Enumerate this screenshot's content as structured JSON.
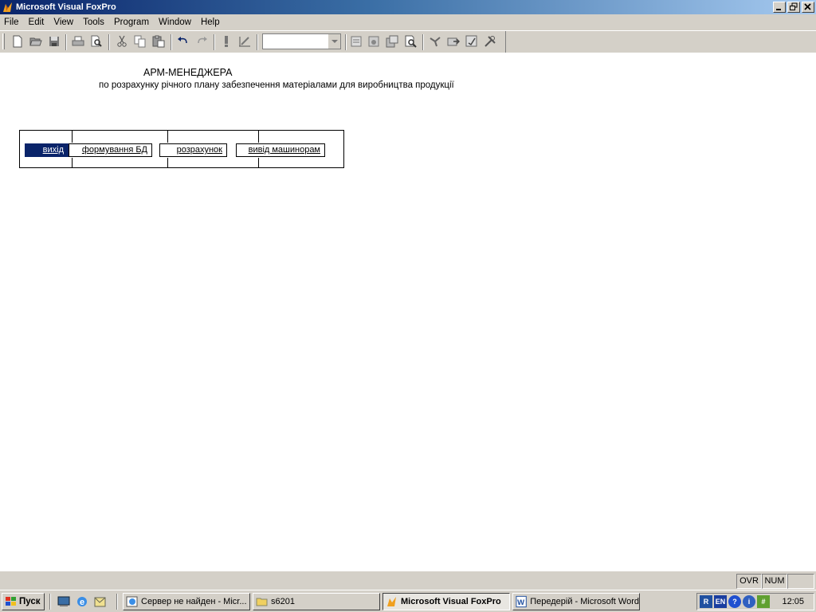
{
  "window": {
    "title": "Microsoft Visual FoxPro"
  },
  "menubar": {
    "items": [
      "File",
      "Edit",
      "View",
      "Tools",
      "Program",
      "Window",
      "Help"
    ]
  },
  "toolbar": {
    "combo_value": "",
    "buttons": [
      "new-icon",
      "open-icon",
      "save-icon",
      "print-icon",
      "print-preview-icon",
      "cut-icon",
      "copy-icon",
      "paste-icon",
      "undo-icon",
      "redo-icon",
      "run-icon",
      "modify-icon",
      "database-icon",
      "form-icon",
      "report-icon",
      "query-icon",
      "connection-icon",
      "import-icon",
      "wizard-icon",
      "builder-icon"
    ]
  },
  "app": {
    "title": "АРМ-МЕНЕДЖЕРА",
    "subtitle": "по розрахунку річного  плану забезпечення матеріалами для виробництва продукції",
    "menu": [
      {
        "label": "вихід",
        "active": true
      },
      {
        "label": "формування БД",
        "active": false
      },
      {
        "label": "розрахунок",
        "active": false
      },
      {
        "label": "вивід машинорам",
        "active": false
      }
    ]
  },
  "statusbar": {
    "ovr": "OVR",
    "num": "NUM",
    "extra": ""
  },
  "taskbar": {
    "start_label": "Пуск",
    "tasks": [
      {
        "label": "Сервер не найден - Micr...",
        "icon": "ie-icon",
        "active": false
      },
      {
        "label": "s6201",
        "icon": "folder-icon",
        "active": false
      },
      {
        "label": "Microsoft Visual FoxPro",
        "icon": "foxpro-icon",
        "active": true
      },
      {
        "label": "Передерій - Microsoft Word",
        "icon": "word-icon",
        "active": false
      }
    ],
    "tray_lang": "EN",
    "clock": "12:05"
  },
  "colors": {
    "titlebar_start": "#0a246a",
    "titlebar_end": "#a6caf0",
    "selection": "#0a246a",
    "face": "#d4d0c8"
  }
}
